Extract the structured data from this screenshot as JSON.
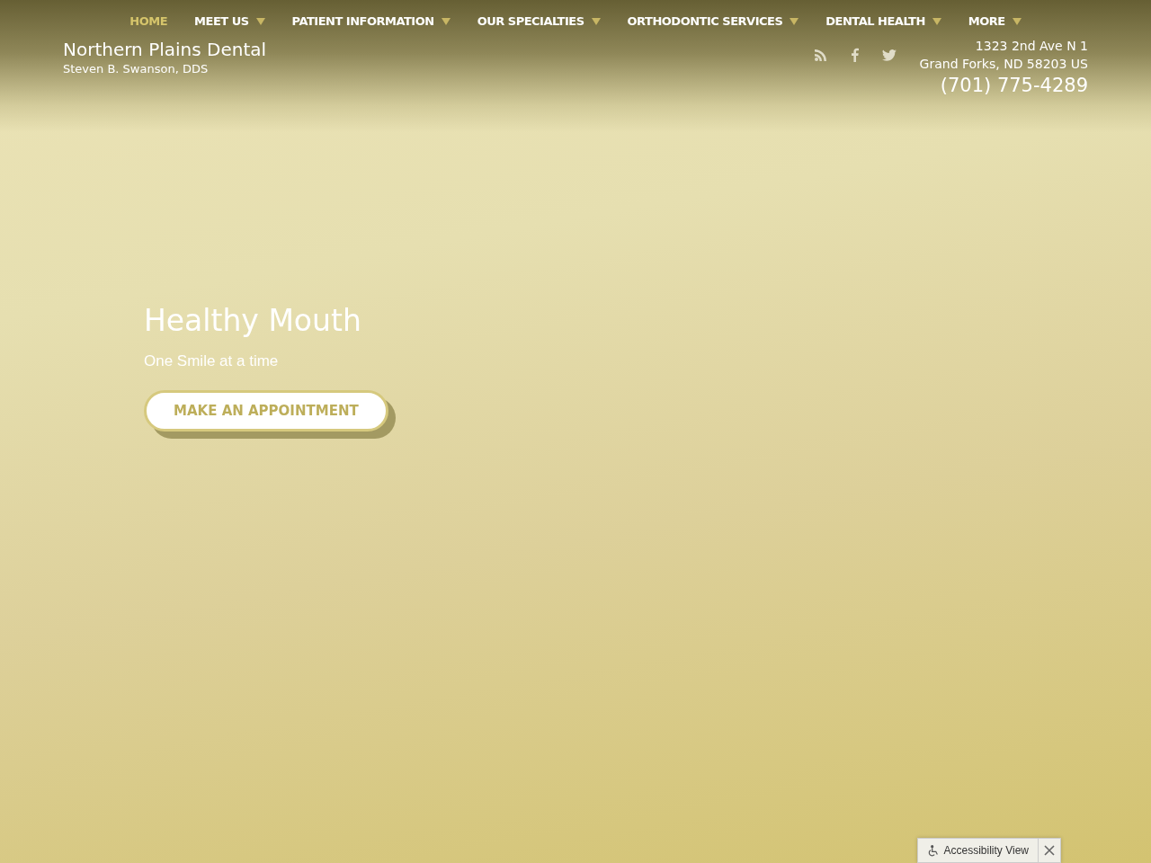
{
  "nav": [
    {
      "label": "HOME",
      "selected": true,
      "dropdown": false
    },
    {
      "label": "MEET US",
      "selected": false,
      "dropdown": true
    },
    {
      "label": "PATIENT INFORMATION",
      "selected": false,
      "dropdown": true
    },
    {
      "label": "OUR SPECIALTIES",
      "selected": false,
      "dropdown": true
    },
    {
      "label": "ORTHODONTIC SERVICES",
      "selected": false,
      "dropdown": true
    },
    {
      "label": "DENTAL HEALTH",
      "selected": false,
      "dropdown": true
    },
    {
      "label": "MORE",
      "selected": false,
      "dropdown": true
    }
  ],
  "brand": {
    "name": "Northern Plains Dental",
    "doctor": "Steven B. Swanson, DDS"
  },
  "social": [
    {
      "kind": "rss"
    },
    {
      "kind": "facebook"
    },
    {
      "kind": "twitter"
    }
  ],
  "contact": {
    "street": "1323 2nd Ave N 1",
    "city": "Grand Forks, ND 58203 US",
    "phone": "(701) 775-4289"
  },
  "hero": {
    "title": "Healthy Mouth",
    "subtitle": "One Smile at a time",
    "button": "MAKE AN APPOINTMENT"
  },
  "accessibility": {
    "label": "Accessibility View"
  }
}
